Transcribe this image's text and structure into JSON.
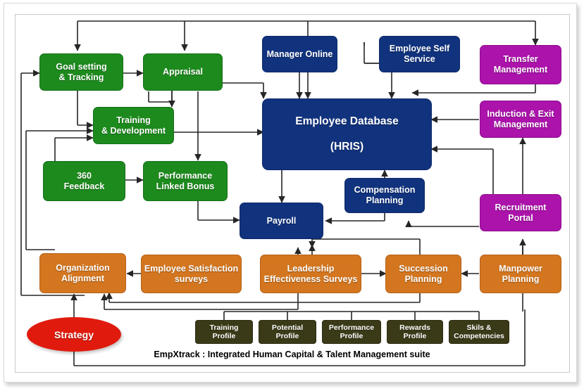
{
  "diagram": {
    "title": "EmpXtrack : Integrated Human Capital & Talent Management suite",
    "caption": "EmpXtrack : Integrated Human Capital & Talent Management suite",
    "colors": {
      "green": "#1d8a1d",
      "navy": "#11337e",
      "magenta": "#ab13ab",
      "orange": "#d3761f",
      "olive": "#3b3a18",
      "red": "#e01b0e",
      "connector": "#262626",
      "background": "#ffffff"
    },
    "groups": {
      "performance_management": "green",
      "core_hris": "navy",
      "employee_lifecycle": "magenta",
      "talent_and_org": "orange",
      "employee_profiles": "olive",
      "strategy": "red"
    },
    "nodes": {
      "goal_setting": "Goal setting\n& Tracking",
      "goal_setting_l1": "Goal setting",
      "goal_setting_l2": "& Tracking",
      "appraisal": "Appraisal",
      "training_l1": "Training",
      "training_l2": "& Development",
      "feedback_l1": "360",
      "feedback_l2": "Feedback",
      "plb_l1": "Performance",
      "plb_l2": "Linked Bonus",
      "manager_online": "Manager Online",
      "ess_l1": "Employee Self",
      "ess_l2": "Service",
      "hris_l1": "Employee Database",
      "hris_l2": "(HRIS)",
      "payroll": "Payroll",
      "comp_l1": "Compensation",
      "comp_l2": "Planning",
      "transfer_l1": "Transfer",
      "transfer_l2": "Management",
      "induction_l1": "Induction & Exit",
      "induction_l2": "Management",
      "recruitment_l1": "Recruitment",
      "recruitment_l2": "Portal",
      "org_align_l1": "Organization",
      "org_align_l2": "Alignment",
      "ess_survey_l1": "Employee Satisfaction",
      "ess_survey_l2": "surveys",
      "leadership_l1": "Leadership",
      "leadership_l2": "Effectiveness Surveys",
      "succession_l1": "Succession",
      "succession_l2": "Planning",
      "manpower_l1": "Manpower",
      "manpower_l2": "Planning",
      "strategy": "Strategy",
      "profile_training_l1": "Training",
      "profile_training_l2": "Profile",
      "profile_potential_l1": "Potential",
      "profile_potential_l2": "Profile",
      "profile_performance_l1": "Performance",
      "profile_performance_l2": "Profile",
      "profile_rewards_l1": "Rewards",
      "profile_rewards_l2": "Profile",
      "profile_skills_l1": "Skils &",
      "profile_skills_l2": "Competencies"
    }
  }
}
